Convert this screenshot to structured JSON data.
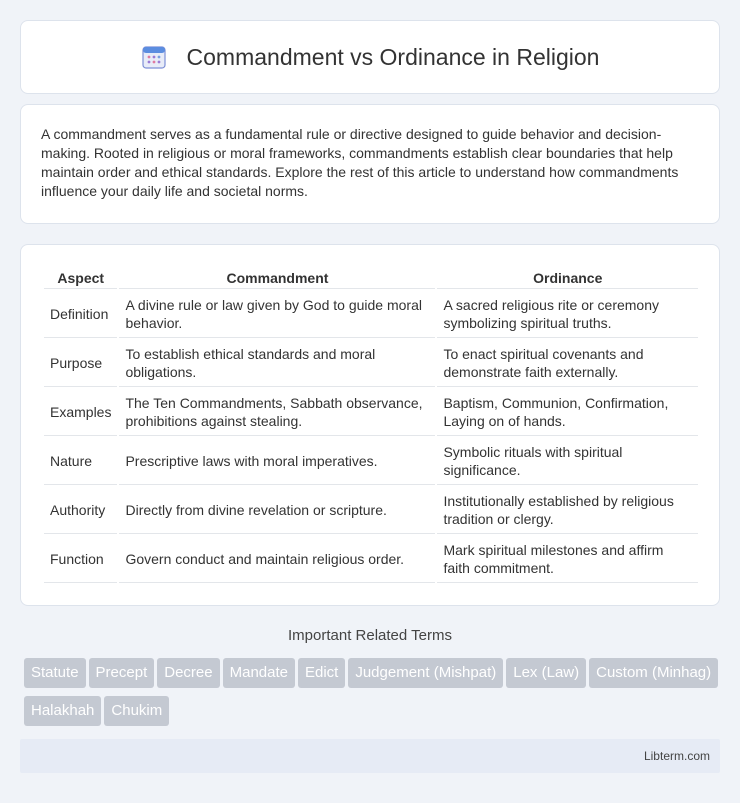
{
  "header": {
    "title": "Commandment vs Ordinance in Religion",
    "icon": "calendar-icon"
  },
  "intro": {
    "text": "A commandment serves as a fundamental rule or directive designed to guide behavior and decision-making. Rooted in religious or moral frameworks, commandments establish clear boundaries that help maintain order and ethical standards. Explore the rest of this article to understand how commandments influence your daily life and societal norms."
  },
  "table": {
    "headers": [
      "Aspect",
      "Commandment",
      "Ordinance"
    ],
    "rows": [
      [
        "Definition",
        "A divine rule or law given by God to guide moral behavior.",
        "A sacred religious rite or ceremony symbolizing spiritual truths."
      ],
      [
        "Purpose",
        "To establish ethical standards and moral obligations.",
        "To enact spiritual covenants and demonstrate faith externally."
      ],
      [
        "Examples",
        "The Ten Commandments, Sabbath observance, prohibitions against stealing.",
        "Baptism, Communion, Confirmation, Laying on of hands."
      ],
      [
        "Nature",
        "Prescriptive laws with moral imperatives.",
        "Symbolic rituals with spiritual significance."
      ],
      [
        "Authority",
        "Directly from divine revelation or scripture.",
        "Institutionally established by religious tradition or clergy."
      ],
      [
        "Function",
        "Govern conduct and maintain religious order.",
        "Mark spiritual milestones and affirm faith commitment."
      ]
    ]
  },
  "related": {
    "title": "Important Related Terms",
    "tags": [
      "Statute",
      "Precept",
      "Decree",
      "Mandate",
      "Edict",
      "Judgement (Mishpat)",
      "Lex (Law)",
      "Custom (Minhag)",
      "Halakhah",
      "Chukim"
    ]
  },
  "footer": {
    "site": "Libterm.com"
  }
}
